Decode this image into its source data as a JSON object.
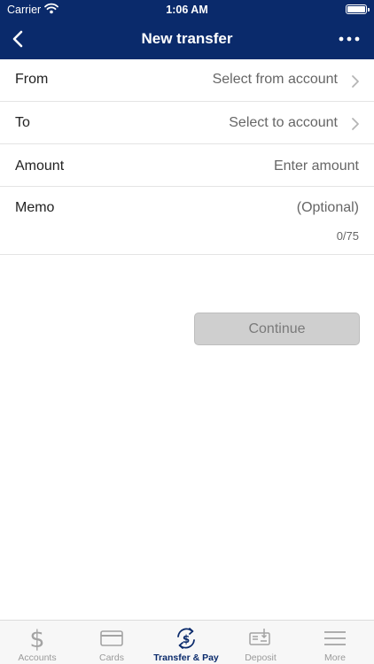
{
  "status_bar": {
    "carrier": "Carrier",
    "time": "1:06 AM"
  },
  "nav": {
    "title": "New transfer",
    "back_icon": "chevron-left-icon",
    "more_icon": "more-dots-icon"
  },
  "form": {
    "from": {
      "label": "From",
      "value": "Select from account"
    },
    "to": {
      "label": "To",
      "value": "Select to account"
    },
    "amount": {
      "label": "Amount",
      "placeholder": "Enter amount"
    },
    "memo": {
      "label": "Memo",
      "placeholder": "(Optional)",
      "counter": "0/75"
    }
  },
  "continue_label": "Continue",
  "tabs": [
    {
      "label": "Accounts",
      "icon": "dollar-icon"
    },
    {
      "label": "Cards",
      "icon": "card-icon"
    },
    {
      "label": "Transfer & Pay",
      "icon": "transfer-icon",
      "active": true
    },
    {
      "label": "Deposit",
      "icon": "check-deposit-icon"
    },
    {
      "label": "More",
      "icon": "menu-icon"
    }
  ],
  "colors": {
    "brand": "#0a2a6b",
    "button_disabled": "#cfcfcf",
    "tab_inactive": "#9a9a9a"
  }
}
